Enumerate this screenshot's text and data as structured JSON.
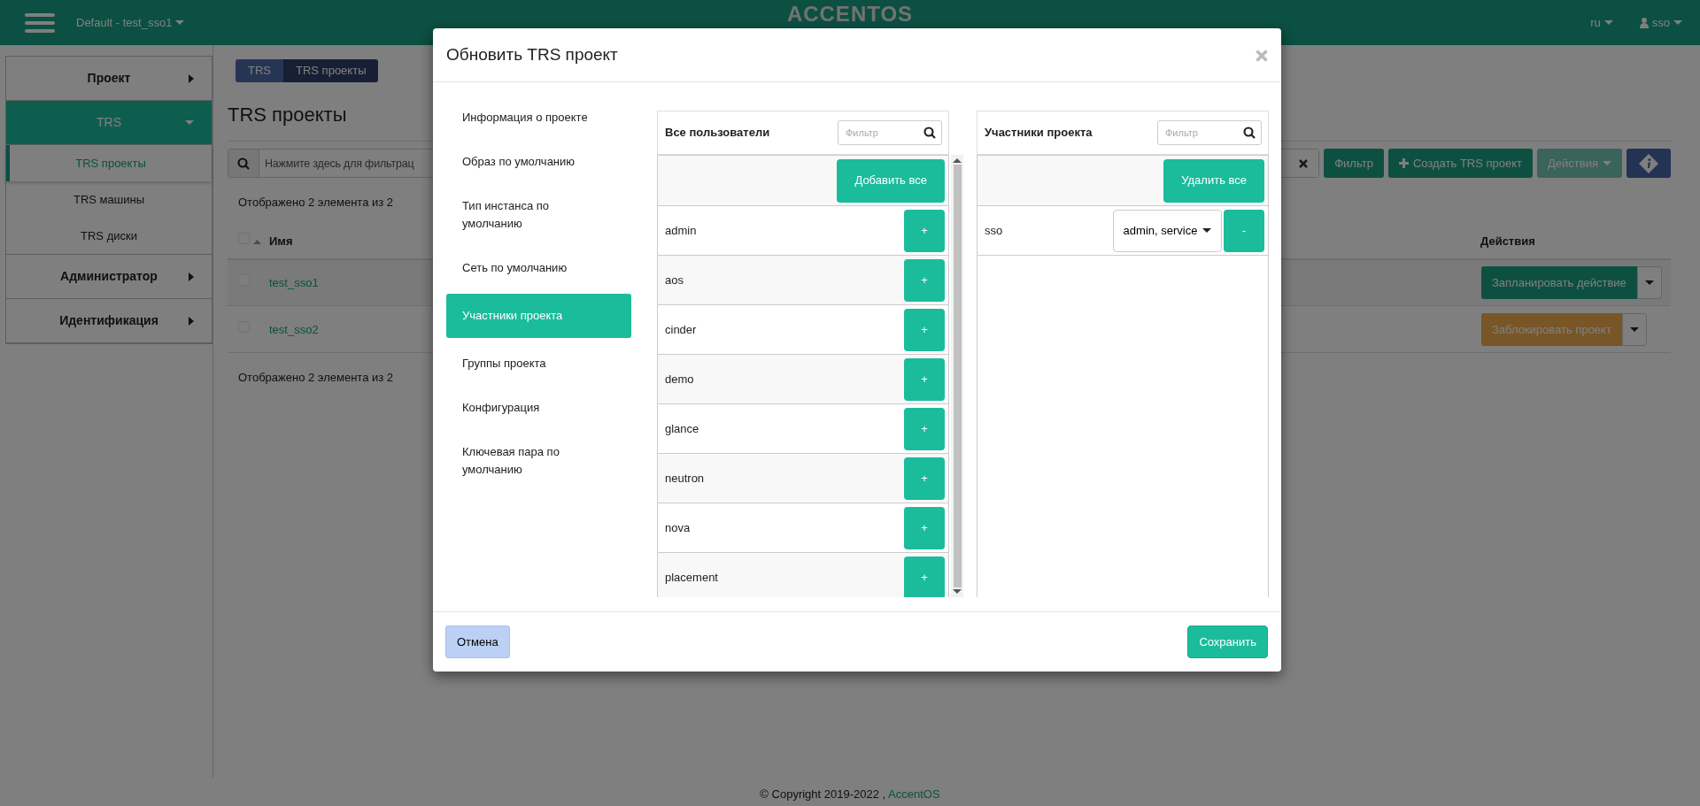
{
  "topbar": {
    "project_selector": "Default - test_sso1",
    "logo": "ACCENTOS",
    "language": "ru",
    "user": "sso"
  },
  "sidebar": {
    "items": [
      {
        "label": "Проект",
        "expanded": false
      },
      {
        "label": "TRS",
        "expanded": true,
        "children": [
          {
            "label": "TRS проекты",
            "selected": true
          },
          {
            "label": "TRS машины",
            "selected": false
          },
          {
            "label": "TRS диски",
            "selected": false
          }
        ]
      },
      {
        "label": "Администратор",
        "expanded": false
      },
      {
        "label": "Идентификация",
        "expanded": false
      }
    ]
  },
  "breadcrumb": [
    "TRS",
    "TRS проекты"
  ],
  "page_title": "TRS проекты",
  "filter": {
    "placeholder": "Нажмите здесь для фильтрац"
  },
  "toolbar": [
    {
      "kind": "filter",
      "label": "Фильтр",
      "disabled": false
    },
    {
      "kind": "create",
      "label": "Создать TRS проект",
      "disabled": false
    },
    {
      "kind": "dropdown",
      "label": "Действия",
      "disabled": true
    },
    {
      "kind": "info",
      "disabled": false
    }
  ],
  "summary_top": "Отображено 2 элемента из 2",
  "table": {
    "select_all_checked": false,
    "columns": [
      "Имя",
      "Действия"
    ],
    "rows": [
      {
        "checked": false,
        "name": "test_sso1",
        "action": {
          "label": "Запланировать действие",
          "kind": "success"
        }
      },
      {
        "checked": false,
        "name": "test_sso2",
        "action": {
          "label": "Заблокировать проект",
          "kind": "warning"
        }
      }
    ]
  },
  "summary_bottom": "Отображено 2 элемента из 2",
  "modal": {
    "title": "Обновить TRS проект",
    "steps": [
      {
        "label": "Информация о проекте",
        "selected": false
      },
      {
        "label": "Образ по умолчанию",
        "selected": false
      },
      {
        "label": "Тип инстанса по умолчанию",
        "selected": false
      },
      {
        "label": "Сеть по умолчанию",
        "selected": false
      },
      {
        "label": "Участники проекта",
        "selected": true
      },
      {
        "label": "Группы проекта",
        "selected": false
      },
      {
        "label": "Конфигурация",
        "selected": false
      },
      {
        "label": "Ключевая пара по умолчанию",
        "selected": false
      }
    ],
    "available": {
      "title": "Все пользователи",
      "filter_placeholder": "Фильтр",
      "bulk_button": "Добавить все",
      "users": [
        {
          "name": "admin",
          "button": "+"
        },
        {
          "name": "aos",
          "button": "+"
        },
        {
          "name": "cinder",
          "button": "+"
        },
        {
          "name": "demo",
          "button": "+"
        },
        {
          "name": "glance",
          "button": "+"
        },
        {
          "name": "neutron",
          "button": "+"
        },
        {
          "name": "nova",
          "button": "+"
        },
        {
          "name": "placement",
          "button": "+"
        }
      ]
    },
    "members": {
      "title": "Участники проекта",
      "filter_placeholder": "Фильтр",
      "bulk_button": "Удалить все",
      "users": [
        {
          "name": "sso",
          "roles": "admin, service",
          "button": "-"
        }
      ]
    },
    "cancel": "Отмена",
    "save": "Сохранить"
  },
  "footer": {
    "text": "© Copyright 2019-2022 , ",
    "link": "AccentOS"
  }
}
